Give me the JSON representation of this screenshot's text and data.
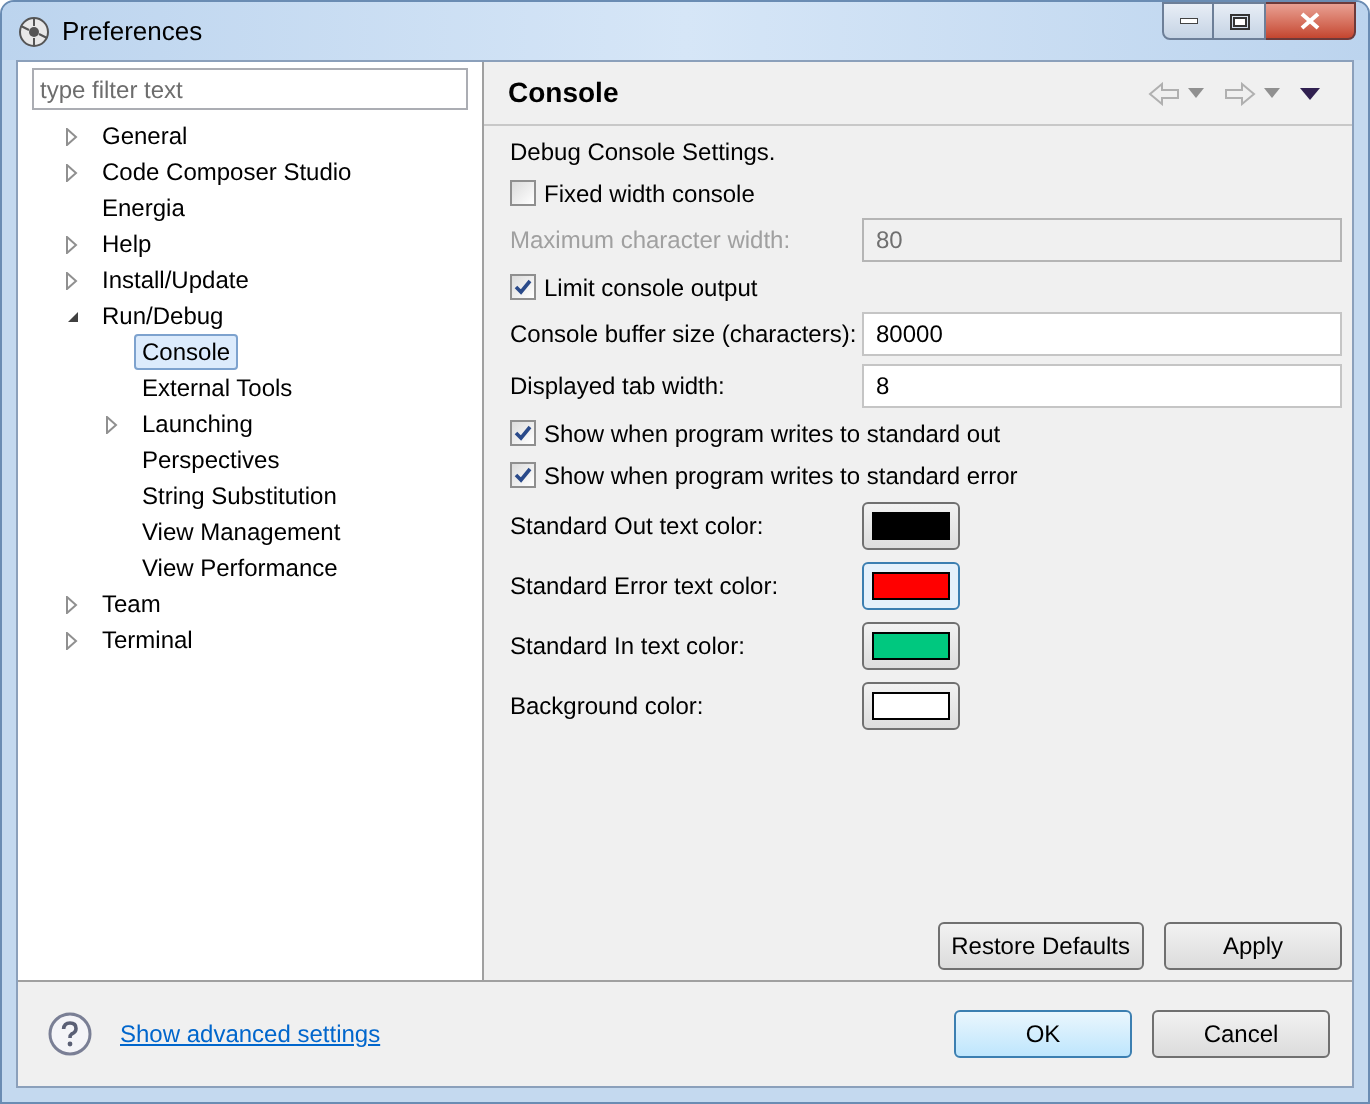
{
  "window": {
    "title": "Preferences"
  },
  "filter": {
    "placeholder": "type filter text"
  },
  "tree": [
    {
      "label": "General",
      "expanded": false,
      "selected": false
    },
    {
      "label": "Code Composer Studio",
      "expanded": false,
      "selected": false
    },
    {
      "label": "Energia",
      "selected": false
    },
    {
      "label": "Help",
      "expanded": false,
      "selected": false
    },
    {
      "label": "Install/Update",
      "expanded": false,
      "selected": false
    },
    {
      "label": "Run/Debug",
      "expanded": true,
      "selected": false,
      "children": [
        {
          "label": "Console",
          "selected": true
        },
        {
          "label": "External Tools",
          "selected": false
        },
        {
          "label": "Launching",
          "expanded": false,
          "selected": false
        },
        {
          "label": "Perspectives",
          "selected": false
        },
        {
          "label": "String Substitution",
          "selected": false
        },
        {
          "label": "View Management",
          "selected": false
        },
        {
          "label": "View Performance",
          "selected": false
        }
      ]
    },
    {
      "label": "Team",
      "expanded": false,
      "selected": false
    },
    {
      "label": "Terminal",
      "expanded": false,
      "selected": false
    }
  ],
  "page": {
    "title": "Console",
    "settings": [
      {
        "kind": "text",
        "label": "Debug Console Settings."
      },
      {
        "kind": "checkbox",
        "label": "Fixed width console",
        "checked": false
      },
      {
        "kind": "field",
        "label": "Maximum character width:",
        "value": "80",
        "disabled": true
      },
      {
        "kind": "checkbox",
        "label": "Limit console output",
        "checked": true
      },
      {
        "kind": "field",
        "label": "Console buffer size (characters):",
        "value": "80000",
        "disabled": false
      },
      {
        "kind": "field",
        "label": "Displayed tab width:",
        "value": "8",
        "disabled": false
      },
      {
        "kind": "checkbox",
        "label": "Show when program writes to standard out",
        "checked": true
      },
      {
        "kind": "checkbox",
        "label": "Show when program writes to standard error",
        "checked": true
      },
      {
        "kind": "color",
        "label": "Standard Out text color:",
        "color": "#000000",
        "focused": false
      },
      {
        "kind": "color",
        "label": "Standard Error text color:",
        "color": "#ff0000",
        "focused": true
      },
      {
        "kind": "color",
        "label": "Standard In text color:",
        "color": "#00c87f",
        "focused": false
      },
      {
        "kind": "color",
        "label": "Background color:",
        "color": "#ffffff",
        "focused": false
      }
    ],
    "buttons": [
      "Restore Defaults",
      "Apply"
    ]
  },
  "footer": {
    "link": "Show advanced settings",
    "buttons": [
      {
        "label": "OK",
        "default": true
      },
      {
        "label": "Cancel",
        "default": false
      }
    ]
  }
}
